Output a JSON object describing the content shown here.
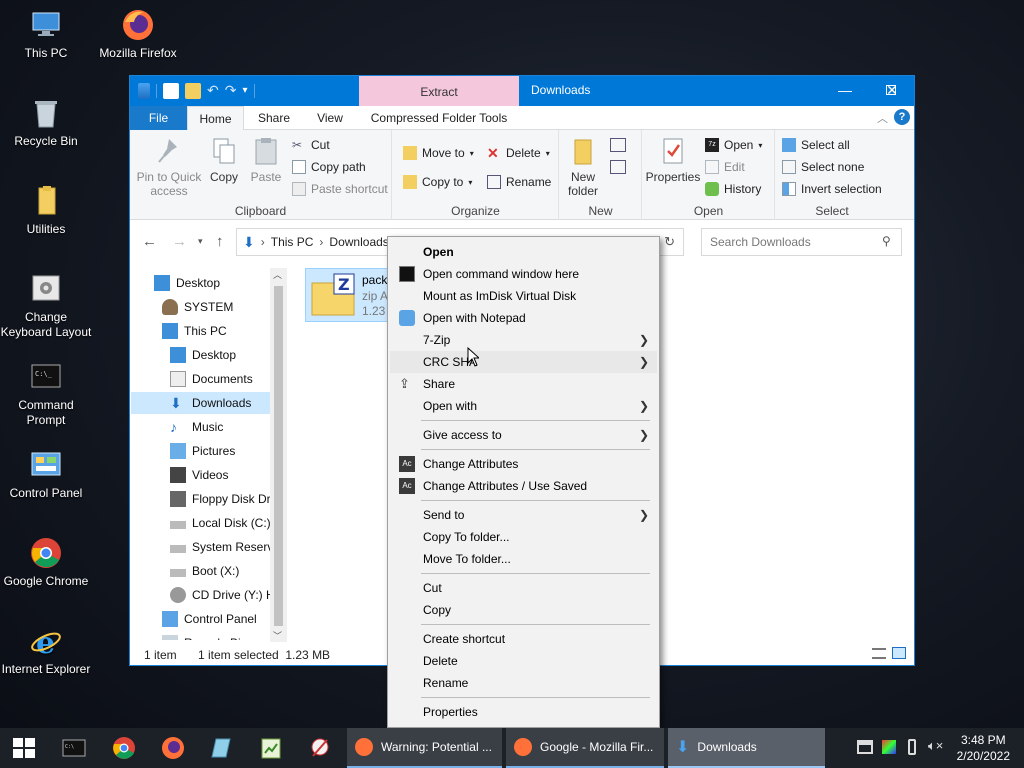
{
  "desktop": {
    "icons": [
      {
        "label": "This PC"
      },
      {
        "label": "Mozilla Firefox"
      },
      {
        "label": "Recycle Bin"
      },
      {
        "label": "Utilities"
      },
      {
        "label": "Change Keyboard Layout"
      },
      {
        "label": "Command Prompt"
      },
      {
        "label": "Control Panel"
      },
      {
        "label": "Google Chrome"
      },
      {
        "label": "Internet Explorer"
      }
    ]
  },
  "window": {
    "title": "Downloads",
    "contextual_tab": "Extract",
    "tabs": [
      "File",
      "Home",
      "Share",
      "View",
      "Compressed Folder Tools"
    ],
    "ribbon": {
      "clipboard": {
        "label": "Clipboard",
        "pin": "Pin to Quick access",
        "copy": "Copy",
        "paste": "Paste",
        "cut": "Cut",
        "copy_path": "Copy path",
        "paste_shortcut": "Paste shortcut"
      },
      "organize": {
        "label": "Organize",
        "move_to": "Move to",
        "copy_to": "Copy to",
        "delete": "Delete",
        "rename": "Rename"
      },
      "new": {
        "label": "New",
        "new_folder": "New folder"
      },
      "open": {
        "label": "Open",
        "properties": "Properties",
        "open": "Open",
        "edit": "Edit",
        "history": "History"
      },
      "select": {
        "label": "Select",
        "select_all": "Select all",
        "select_none": "Select none",
        "invert": "Invert selection"
      }
    },
    "address": {
      "crumbs": [
        "This PC",
        "Downloads"
      ],
      "search_placeholder": "Search Downloads"
    },
    "nav_pane": [
      {
        "label": "Desktop"
      },
      {
        "label": "SYSTEM"
      },
      {
        "label": "This PC"
      },
      {
        "label": "Desktop"
      },
      {
        "label": "Documents"
      },
      {
        "label": "Downloads"
      },
      {
        "label": "Music"
      },
      {
        "label": "Pictures"
      },
      {
        "label": "Videos"
      },
      {
        "label": "Floppy Disk Dri"
      },
      {
        "label": "Local Disk (C:)"
      },
      {
        "label": "System Reserve"
      },
      {
        "label": "Boot (X:)"
      },
      {
        "label": "CD Drive (Y:) H"
      },
      {
        "label": "Control Panel"
      },
      {
        "label": "Recycle Bin"
      }
    ],
    "file": {
      "name": "pack",
      "type": "zip A",
      "size": "1.23"
    },
    "status": {
      "count": "1 item",
      "selected": "1 item selected  1.23 MB"
    }
  },
  "context_menu": {
    "items": [
      {
        "label": "Open"
      },
      {
        "label": "Open command window here"
      },
      {
        "label": "Mount as ImDisk Virtual Disk"
      },
      {
        "label": "Open with Notepad"
      },
      {
        "label": "7-Zip"
      },
      {
        "label": "CRC SHA"
      },
      {
        "label": "Share"
      },
      {
        "label": "Open with"
      },
      {
        "label": "Give access to"
      },
      {
        "label": "Change Attributes"
      },
      {
        "label": "Change Attributes / Use Saved"
      },
      {
        "label": "Send to"
      },
      {
        "label": "Copy To folder..."
      },
      {
        "label": "Move To folder..."
      },
      {
        "label": "Cut"
      },
      {
        "label": "Copy"
      },
      {
        "label": "Create shortcut"
      },
      {
        "label": "Delete"
      },
      {
        "label": "Rename"
      },
      {
        "label": "Properties"
      }
    ]
  },
  "taskbar": {
    "tasks": [
      {
        "label": "Warning: Potential ..."
      },
      {
        "label": "Google - Mozilla Fir..."
      },
      {
        "label": "Downloads"
      }
    ],
    "clock": {
      "time": "3:48 PM",
      "date": "2/20/2022"
    }
  },
  "colors": {
    "accent": "#0078d7",
    "extract_tab": "#f4c7dd",
    "selection": "#cce8ff",
    "taskbar": "#1c2027"
  }
}
